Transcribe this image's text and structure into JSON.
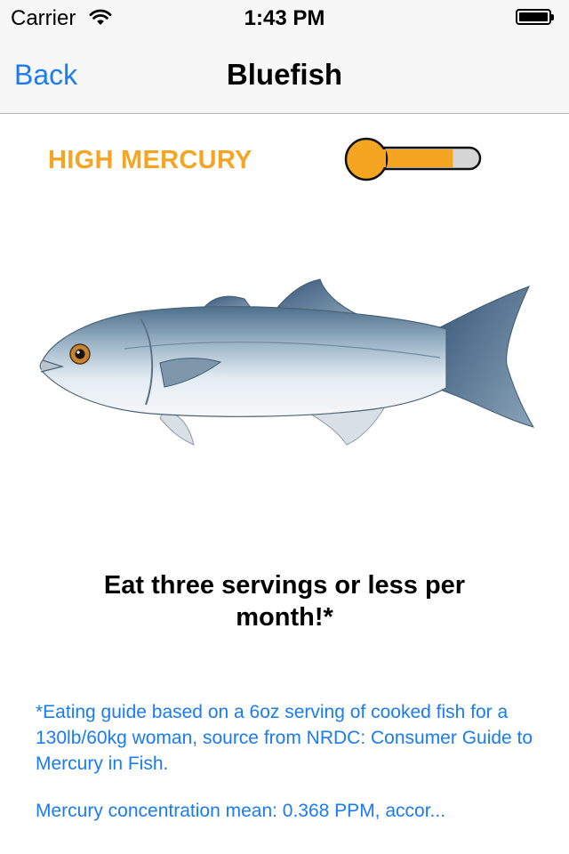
{
  "status_bar": {
    "carrier": "Carrier",
    "time": "1:43 PM",
    "battery_level": 1.0
  },
  "nav": {
    "back_label": "Back",
    "title": "Bluefish"
  },
  "mercury_level": {
    "label": "HIGH MERCURY",
    "gauge_fill": 0.78,
    "color": "#f6a522"
  },
  "fish_image": {
    "icon": "bluefish-illustration"
  },
  "advice": "Eat three servings or less per month!*",
  "footnote": "*Eating guide based on a 6oz serving of cooked fish for a 130lb/60kg woman, source from NRDC: Consumer Guide to Mercury in Fish.",
  "mercury_concentration": "Mercury concentration mean: 0.368 PPM, accor...",
  "colors": {
    "link": "#1a7cf0",
    "warning": "#f6a522",
    "bar_background": "#f7f7f7"
  }
}
